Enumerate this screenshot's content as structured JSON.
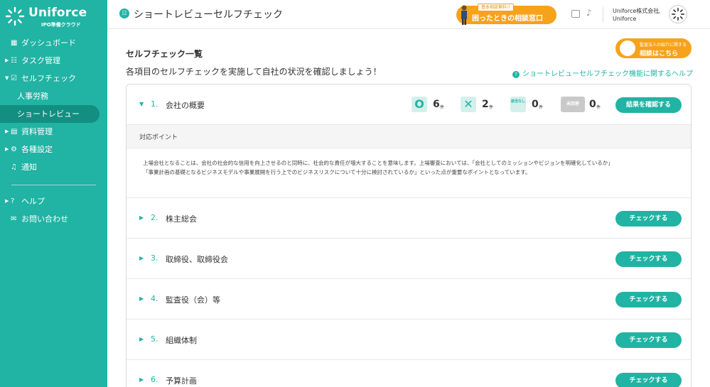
{
  "brand": {
    "name": "Uniforce",
    "subtitle": "IPO準備クラウド"
  },
  "sidebar": {
    "items": [
      {
        "label": "ダッシュボード",
        "icon": "grid-icon",
        "caret": ""
      },
      {
        "label": "タスク管理",
        "icon": "task-icon",
        "caret": "▶"
      },
      {
        "label": "セルフチェック",
        "icon": "checklist-icon",
        "caret": "▼"
      },
      {
        "label": "人事労務",
        "icon": "",
        "caret": ""
      },
      {
        "label": "ショートレビュー",
        "icon": "",
        "caret": ""
      },
      {
        "label": "資料管理",
        "icon": "document-icon",
        "caret": "▶"
      },
      {
        "label": "各種設定",
        "icon": "gear-icon",
        "caret": "▶"
      },
      {
        "label": "通知",
        "icon": "bell-icon",
        "caret": ""
      },
      {
        "label": "ヘルプ",
        "icon": "help-icon",
        "caret": "▶"
      },
      {
        "label": "お問い合わせ",
        "icon": "mail-icon",
        "caret": ""
      }
    ]
  },
  "header": {
    "title": "ショートレビューセルフチェック",
    "consult_badge": "基本相談無料!!",
    "consult_label": "困ったときの相談窓口",
    "company": "Uniforce株式会社",
    "user": "Uniforce"
  },
  "main": {
    "section_title": "セルフチェック一覧",
    "description": "各項目のセルフチェックを実施して自社の状況を確認しましょう！",
    "help_link": "ショートレビューセルフチェック機能に関するヘルプ",
    "kansa_line1": "監査法人の紹介に関する",
    "kansa_line2": "相談はこちら",
    "stats": {
      "ok_symbol": "O",
      "ng_symbol": "✕",
      "na_label": "該当なし",
      "unanswered_label": "未回答",
      "ok_count": "6",
      "ng_count": "2",
      "na_count": "0",
      "unanswered_count": "0",
      "unit": "件"
    },
    "points_header": "対応ポイント",
    "points_text": "上場会社となることは、会社の社会的な信用を向上させるのと同時に、社会的な責任が増大することを意味します。上場審査においては、「会社としてのミッションやビジョンを明確化しているか」「事業計画の基礎となるビジネスモデルや事業展開を行う上でのビジネスリスクについて十分に検討されているか」といった点が重要なポイントとなっています。",
    "items": [
      {
        "number": "1.",
        "name": "会社の概要",
        "button": "結果を確認する"
      },
      {
        "number": "2.",
        "name": "株主総会",
        "button": "チェックする"
      },
      {
        "number": "3.",
        "name": "取締役、取締役会",
        "button": "チェックする"
      },
      {
        "number": "4.",
        "name": "監査役（会）等",
        "button": "チェックする"
      },
      {
        "number": "5.",
        "name": "組織体制",
        "button": "チェックする"
      },
      {
        "number": "6.",
        "name": "予算計画",
        "button": "チェックする"
      }
    ]
  },
  "colors": {
    "accent": "#21b3a3",
    "accent_dark": "#138f82",
    "orange": "#f7a21b"
  }
}
